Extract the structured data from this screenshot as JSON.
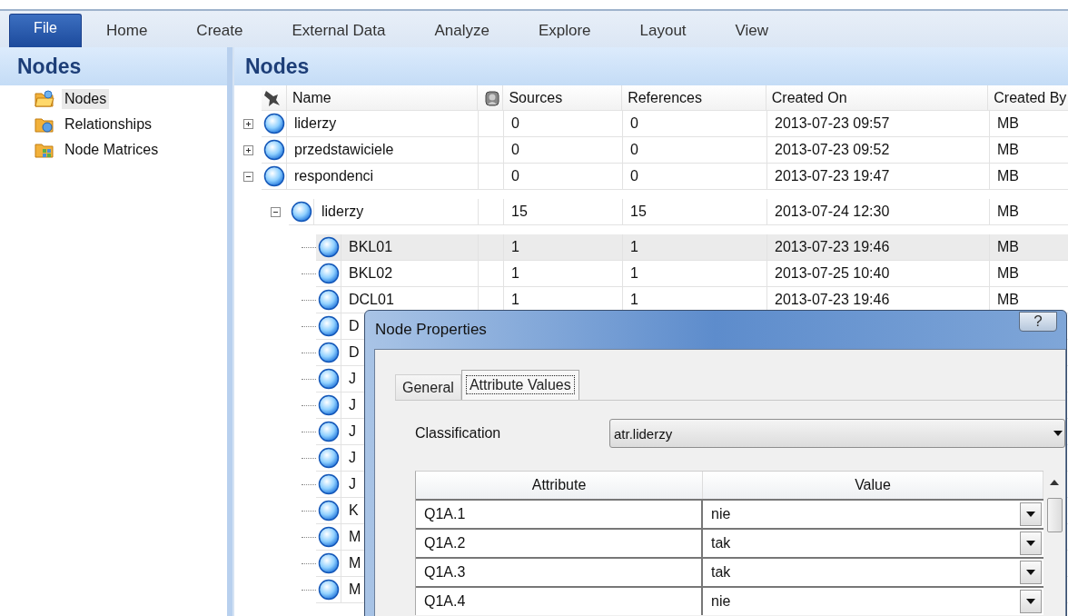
{
  "menu": {
    "file": "File",
    "tabs": [
      "Home",
      "Create",
      "External Data",
      "Analyze",
      "Explore",
      "Layout",
      "View"
    ]
  },
  "sidebar": {
    "title": "Nodes",
    "items": [
      {
        "label": "Nodes",
        "selected": true,
        "kind": "nodes"
      },
      {
        "label": "Relationships",
        "selected": false,
        "kind": "relationships"
      },
      {
        "label": "Node Matrices",
        "selected": false,
        "kind": "matrices"
      }
    ]
  },
  "list": {
    "title": "Nodes",
    "columns": [
      "Name",
      "Sources",
      "References",
      "Created On",
      "Created By"
    ],
    "nodes": [
      {
        "name": "liderzy",
        "sources": "0",
        "references": "0",
        "created_on": "2013-07-23 09:57",
        "created_by": "MB",
        "expanded": false,
        "selected": false
      },
      {
        "name": "przedstawiciele",
        "sources": "0",
        "references": "0",
        "created_on": "2013-07-23 09:52",
        "created_by": "MB",
        "expanded": false,
        "selected": false
      },
      {
        "name": "respondenci",
        "sources": "0",
        "references": "0",
        "created_on": "2013-07-23 19:47",
        "created_by": "MB",
        "expanded": true,
        "selected": false,
        "children": [
          {
            "name": "liderzy",
            "sources": "15",
            "references": "15",
            "created_on": "2013-07-24 12:30",
            "created_by": "MB",
            "expanded": true,
            "selected": false,
            "children": [
              {
                "name": "BKL01",
                "sources": "1",
                "references": "1",
                "created_on": "2013-07-23 19:46",
                "created_by": "MB",
                "selected": true
              },
              {
                "name": "BKL02",
                "sources": "1",
                "references": "1",
                "created_on": "2013-07-25 10:40",
                "created_by": "MB",
                "selected": false
              },
              {
                "name": "DCL01",
                "sources": "1",
                "references": "1",
                "created_on": "2013-07-23 19:46",
                "created_by": "MB",
                "selected": false
              },
              {
                "name": "D",
                "selected": false
              },
              {
                "name": "D",
                "selected": false
              },
              {
                "name": "J",
                "selected": false
              },
              {
                "name": "J",
                "selected": false
              },
              {
                "name": "J",
                "selected": false
              },
              {
                "name": "J",
                "selected": false
              },
              {
                "name": "J",
                "selected": false
              },
              {
                "name": "K",
                "selected": false
              },
              {
                "name": "M",
                "selected": false
              },
              {
                "name": "M",
                "selected": false
              },
              {
                "name": "M",
                "selected": false
              }
            ]
          }
        ]
      }
    ]
  },
  "dialog": {
    "title": "Node Properties",
    "help": "?",
    "tabs": [
      {
        "label": "General",
        "selected": false
      },
      {
        "label": "Attribute Values",
        "selected": true
      }
    ],
    "classification": {
      "label": "Classification",
      "value": "atr.liderzy"
    },
    "grid": {
      "columns": [
        "Attribute",
        "Value"
      ],
      "rows": [
        {
          "attribute": "Q1A.1",
          "value": "nie"
        },
        {
          "attribute": "Q1A.2",
          "value": "tak"
        },
        {
          "attribute": "Q1A.3",
          "value": "tak"
        },
        {
          "attribute": "Q1A.4",
          "value": "nie"
        }
      ]
    }
  }
}
